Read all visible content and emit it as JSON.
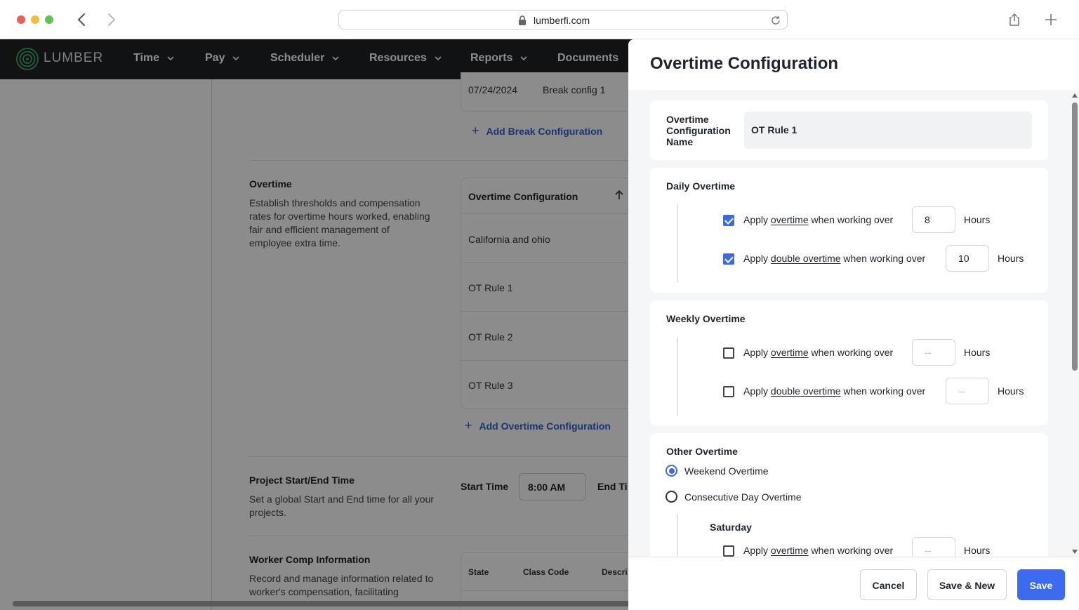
{
  "browser": {
    "url": "lumberfi.com"
  },
  "app": {
    "logo_text": "LUMBER",
    "nav": [
      "Time",
      "Pay",
      "Scheduler",
      "Resources",
      "Reports",
      "Documents"
    ]
  },
  "background": {
    "break_row": {
      "date": "07/24/2024",
      "name": "Break config 1"
    },
    "add_break": "Add Break Configuration",
    "overtime": {
      "title": "Overtime",
      "desc_lines": [
        "Establish thresholds and compensation",
        "rates for overtime hours worked, enabling",
        "fair and efficient management of",
        "employee extra time."
      ],
      "table_header": "Overtime Configuration",
      "rows": [
        "California and ohio",
        "OT Rule 1",
        "OT Rule 2",
        "OT Rule 3"
      ],
      "add_label": "Add Overtime Configuration"
    },
    "project_time": {
      "title": "Project Start/End Time",
      "desc_lines": [
        "Set a global Start and End time for all your",
        "projects."
      ],
      "start_label": "Start Time",
      "start_value": "8:00 AM",
      "end_label": "End Ti"
    },
    "worker_comp": {
      "title": "Worker Comp Information",
      "desc_lines": [
        "Record and manage information related to",
        "worker's compensation, facilitating"
      ],
      "columns": [
        "State",
        "Class Code",
        "Descri"
      ]
    }
  },
  "panel": {
    "title": "Overtime Configuration",
    "name_label_lines": [
      "Overtime",
      "Configuration",
      "Name"
    ],
    "name_value": "OT Rule 1",
    "daily": {
      "title": "Daily Overtime",
      "ot": {
        "prefix": "Apply ",
        "link": "overtime",
        "suffix": " when working over",
        "value": "8",
        "checked": true
      },
      "dot": {
        "prefix": "Apply ",
        "link": "double overtime",
        "suffix": " when working over",
        "value": "10",
        "checked": true
      }
    },
    "weekly": {
      "title": "Weekly Overtime",
      "ot": {
        "prefix": "Apply ",
        "link": "overtime",
        "suffix": " when working over",
        "placeholder": "--",
        "checked": false
      },
      "dot": {
        "prefix": "Apply ",
        "link": "double overtime",
        "suffix": " when working over",
        "placeholder": "--",
        "checked": false
      }
    },
    "other": {
      "title": "Other Overtime",
      "options": [
        "Weekend Overtime",
        "Consecutive Day Overtime"
      ],
      "selected": "Weekend Overtime",
      "saturday_label": "Saturday",
      "sat_ot": {
        "prefix": "Apply ",
        "link": "overtime",
        "suffix": " when working over",
        "placeholder": "--",
        "checked": false
      }
    },
    "hours_label": "Hours",
    "buttons": {
      "cancel": "Cancel",
      "save_new": "Save & New",
      "save": "Save"
    }
  },
  "colors": {
    "accent": "#3d6bf0",
    "nav_bg": "#1f2226",
    "link": "#2d5fd4"
  }
}
